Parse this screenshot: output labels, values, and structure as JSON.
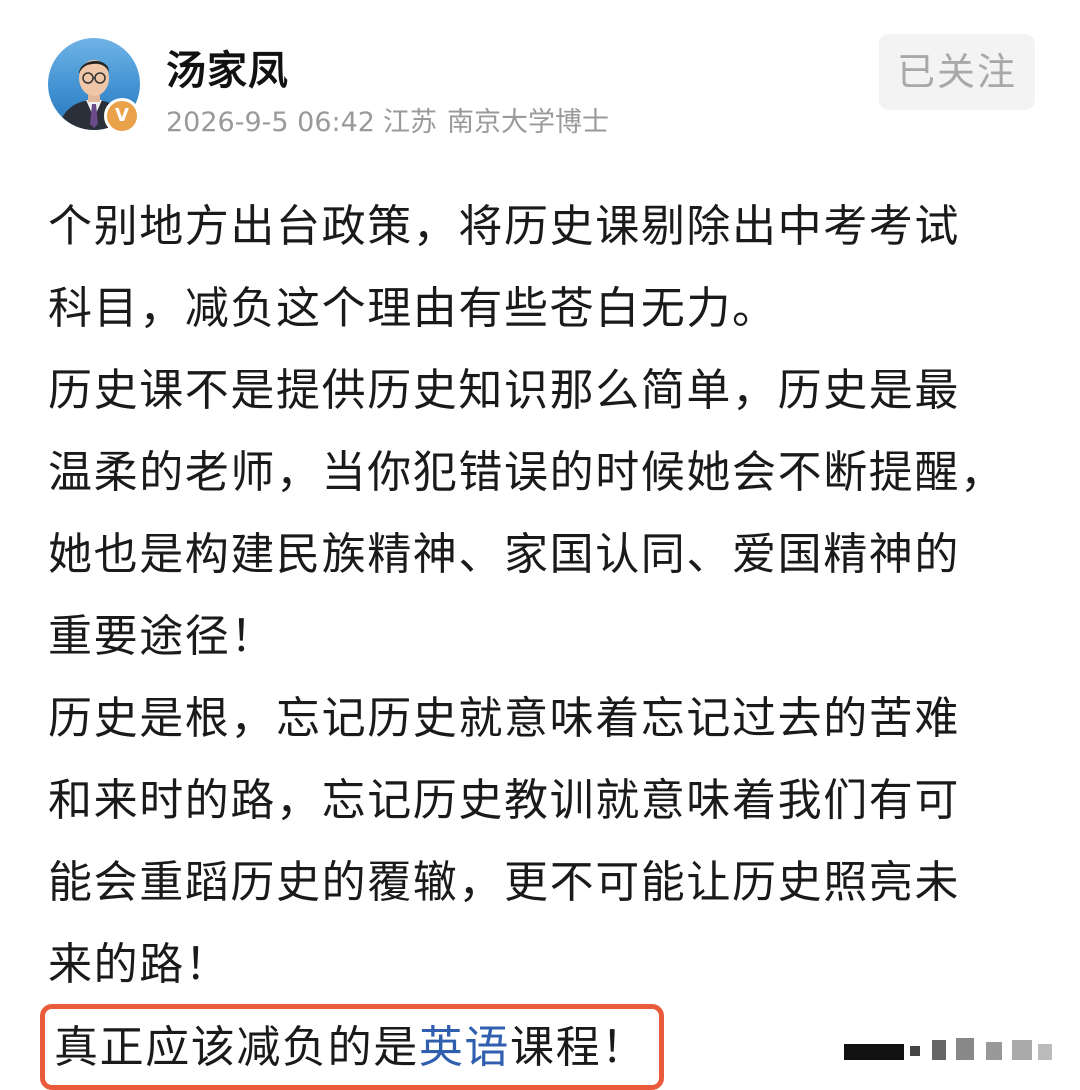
{
  "header": {
    "author_name": "汤家凤",
    "verified_badge": "V",
    "timestamp": "2026-9-5 06:42",
    "location": "江苏",
    "credential": "南京大学博士",
    "follow_label": "已关注"
  },
  "post": {
    "lines": [
      "个别地方出台政策，将历史课剔除出中考考试",
      "科目，减负这个理由有些苍白无力。",
      "历史课不是提供历史知识那么简单，历史是最",
      "温柔的老师，当你犯错误的时候她会不断提醒，",
      "她也是构建民族精神、家国认同、爱国精神的",
      "重要途径！",
      "历史是根，忘记历史就意味着忘记过去的苦难",
      "和来时的路，忘记历史教训就意味着我们有可",
      "能会重蹈历史的覆辙，更不可能让历史照亮未",
      "来的路！"
    ],
    "highlight": {
      "before": "真正应该减负的是",
      "link": "英语",
      "after": "课程！"
    }
  },
  "colors": {
    "highlight_border": "#ea5b3c",
    "link": "#2f5fae",
    "meta_text": "#9a9a9a",
    "follow_bg": "#f3f3f3",
    "badge": "#e9a24a"
  },
  "icons": {
    "avatar": "author-photo",
    "badge": "verified-v-badge"
  }
}
